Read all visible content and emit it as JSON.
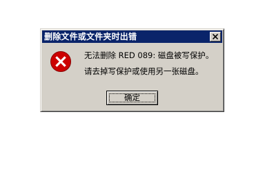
{
  "dialog": {
    "title": "删除文件或文件夹时出错",
    "icon": "error-icon",
    "message_line1": "无法删除 RED 089: 磁盘被写保护。",
    "message_line2": "请去掉写保护或使用另一张磁盘。",
    "ok_label": "确定",
    "close_icon": "close-icon"
  },
  "colors": {
    "titlebar": "#0a246a",
    "dialog_face": "#d4d0c8",
    "error_red": "#cc0000"
  }
}
